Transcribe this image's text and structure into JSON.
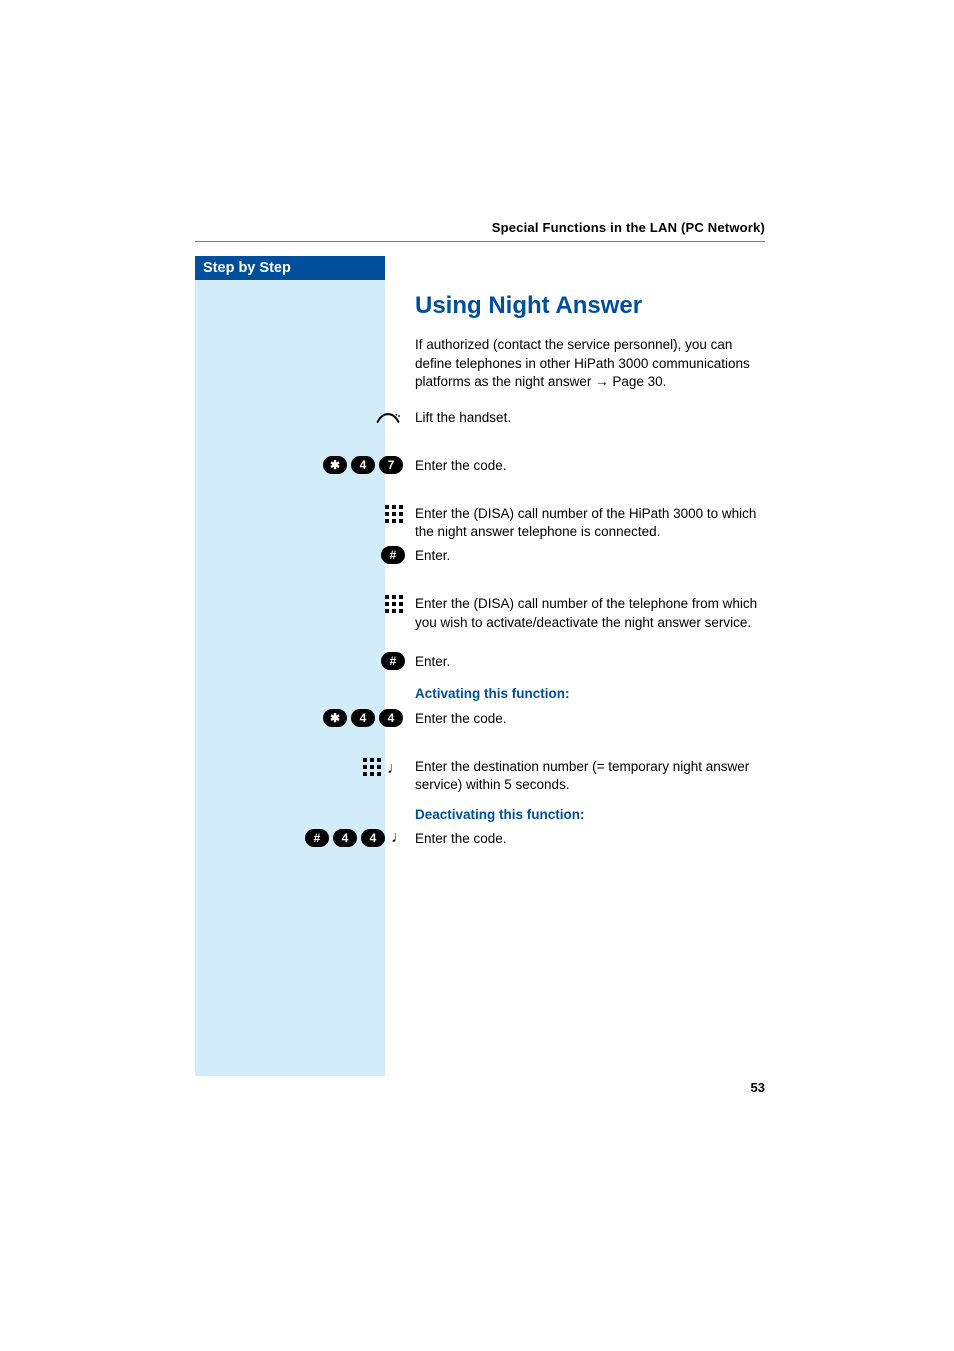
{
  "header": {
    "running_head": "Special Functions in the LAN (PC Network)"
  },
  "sidebar": {
    "tab_label": "Step by Step"
  },
  "content": {
    "title": "Using Night Answer",
    "intro_part1": "If authorized (contact the service personnel), you can define telephones in other HiPath 3000 communications platforms as the night answer ",
    "intro_link_arrow": "→",
    "intro_link_text": " Page 30.",
    "steps": {
      "lift_handset": "Lift the handset.",
      "enter_code_1": "Enter the code.",
      "enter_disa_1": "Enter the (DISA) call number of the HiPath 3000 to which the night answer telephone is connected.",
      "enter_1": "Enter.",
      "enter_disa_2": "Enter the (DISA) call number of the telephone from which you wish to activate/deactivate the night answer service.",
      "enter_2": "Enter.",
      "activating_heading": "Activating this function:",
      "enter_code_2": "Enter the code.",
      "enter_destination": "Enter the destination number (= temporary night answer service) within 5 seconds.",
      "deactivating_heading": "Deactivating this function:",
      "enter_code_3": "Enter the code."
    },
    "keys": {
      "star": "✱",
      "hash": "#",
      "d4": "4",
      "d7": "7"
    }
  },
  "page_number": "53"
}
